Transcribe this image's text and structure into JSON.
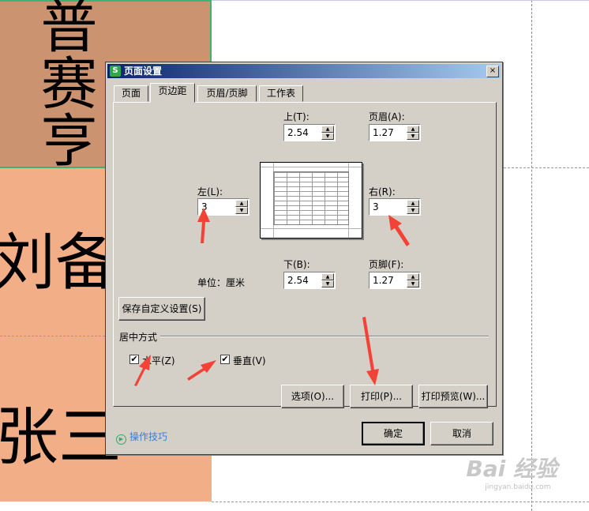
{
  "sheet": {
    "cell_top_text": "普赛亨",
    "cell_mid_text": "刘备",
    "cell_bot_text": "张三"
  },
  "dialog": {
    "title": "页面设置",
    "close": "×",
    "tabs": [
      "页面",
      "页边距",
      "页眉/页脚",
      "工作表"
    ],
    "active_tab": "页边距",
    "top": {
      "label": "上(T):",
      "value": "2.54"
    },
    "header": {
      "label": "页眉(A):",
      "value": "1.27"
    },
    "left": {
      "label": "左(L):",
      "value": "3"
    },
    "right": {
      "label": "右(R):",
      "value": "3"
    },
    "bottom": {
      "label": "下(B):",
      "value": "2.54"
    },
    "footer": {
      "label": "页脚(F):",
      "value": "1.27"
    },
    "unit_label": "单位：厘米",
    "save_custom_label": "保存自定义设置(S)",
    "center_group_title": "居中方式",
    "horizontal": {
      "label": "水平(Z)",
      "checked": true
    },
    "vertical": {
      "label": "垂直(V)",
      "checked": true
    },
    "options_label": "选项(O)...",
    "print_label": "打印(P)...",
    "print_preview_label": "打印预览(W)...",
    "tips_label": "操作技巧",
    "ok_label": "确定",
    "cancel_label": "取消"
  },
  "watermark": {
    "logo": "Bai 经验",
    "sub": "jingyan.baidu.com"
  },
  "colors": {
    "arrow": "#f44336",
    "cell_orange": "#f2ae86",
    "cell_brown": "#cc9370",
    "dialog_bg": "#d4d0c8",
    "title_start": "#0a246a",
    "link": "#3a7fd0"
  }
}
